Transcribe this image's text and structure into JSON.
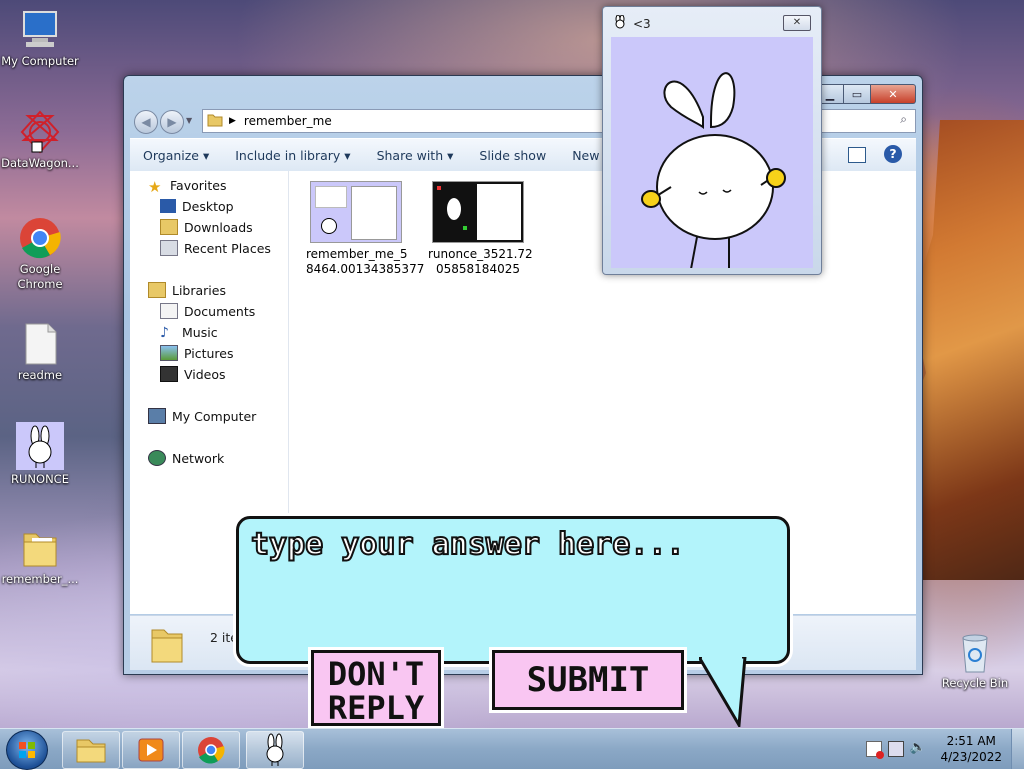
{
  "desktop": {
    "icons": [
      {
        "label": "My Computer",
        "icon": "computer-icon"
      },
      {
        "label": "DataWagon...",
        "icon": "datawagon-icon"
      },
      {
        "label": "Google Chrome",
        "icon": "chrome-icon"
      },
      {
        "label": "readme",
        "icon": "text-file-icon"
      },
      {
        "label": "RUNONCE",
        "icon": "bunny-icon"
      },
      {
        "label": "remember_...",
        "icon": "folder-icon"
      },
      {
        "label": "Recycle Bin",
        "icon": "recycle-bin-icon"
      }
    ]
  },
  "explorer": {
    "address": "remember_me",
    "toolbar": [
      "Organize",
      "Include in library",
      "Share with",
      "Slide show",
      "New fold"
    ],
    "nav": {
      "favorites": "Favorites",
      "desktop": "Desktop",
      "downloads": "Downloads",
      "recent": "Recent Places",
      "libraries": "Libraries",
      "documents": "Documents",
      "music": "Music",
      "pictures": "Pictures",
      "videos": "Videos",
      "computer": "My Computer",
      "network": "Network"
    },
    "files": [
      {
        "line1": "remember_me_5",
        "line2": "8464.00134385377"
      },
      {
        "line1": "runonce_3521.72",
        "line2": "05858184025"
      }
    ],
    "status": "2 ite"
  },
  "popup": {
    "title": "<3"
  },
  "bubble": {
    "placeholder": "type your answer here...",
    "dont_reply": "DON'T REPLY",
    "dont_reply_1": "DON'T",
    "dont_reply_2": "REPLY",
    "submit": "SUBMIT"
  },
  "taskbar": {
    "time": "2:51 AM",
    "date": "4/23/2022"
  },
  "colors": {
    "bubble": "#b3f4fb",
    "button": "#f9c6f2",
    "popup_bg": "#cbc8fa"
  }
}
